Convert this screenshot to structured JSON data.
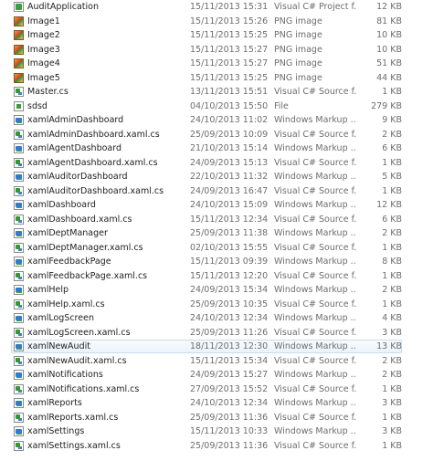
{
  "files": [
    {
      "name": "AuditApplication",
      "date": "15/11/2013 15:31",
      "type": "Visual C# Project f...",
      "size": "12 KB",
      "icon": "project-icon"
    },
    {
      "name": "Image1",
      "date": "15/11/2013 15:26",
      "type": "PNG image",
      "size": "81 KB",
      "icon": "png-icon"
    },
    {
      "name": "Image2",
      "date": "15/11/2013 15:25",
      "type": "PNG image",
      "size": "10 KB",
      "icon": "png-icon"
    },
    {
      "name": "Image3",
      "date": "15/11/2013 15:27",
      "type": "PNG image",
      "size": "10 KB",
      "icon": "png-icon"
    },
    {
      "name": "Image4",
      "date": "15/11/2013 15:27",
      "type": "PNG image",
      "size": "51 KB",
      "icon": "png-icon"
    },
    {
      "name": "Image5",
      "date": "15/11/2013 15:25",
      "type": "PNG image",
      "size": "44 KB",
      "icon": "png-icon"
    },
    {
      "name": "Master.cs",
      "date": "13/11/2013 15:51",
      "type": "Visual C# Source f...",
      "size": "1 KB",
      "icon": "cs-icon"
    },
    {
      "name": "sdsd",
      "date": "04/10/2013 15:50",
      "type": "File",
      "size": "279 KB",
      "icon": "file-icon"
    },
    {
      "name": "xamlAdminDashboard",
      "date": "24/10/2013 11:02",
      "type": "Windows Markup ...",
      "size": "9 KB",
      "icon": "xaml-icon"
    },
    {
      "name": "xamlAdminDashboard.xaml.cs",
      "date": "25/09/2013 10:09",
      "type": "Visual C# Source f...",
      "size": "2 KB",
      "icon": "cs-icon"
    },
    {
      "name": "xamlAgentDashboard",
      "date": "21/10/2013 15:14",
      "type": "Windows Markup ...",
      "size": "6 KB",
      "icon": "xaml-icon"
    },
    {
      "name": "xamlAgentDashboard.xaml.cs",
      "date": "24/09/2013 15:13",
      "type": "Visual C# Source f...",
      "size": "1 KB",
      "icon": "cs-icon"
    },
    {
      "name": "xamlAuditorDashboard",
      "date": "22/10/2013 11:32",
      "type": "Windows Markup ...",
      "size": "5 KB",
      "icon": "xaml-icon"
    },
    {
      "name": "xamlAuditorDashboard.xaml.cs",
      "date": "24/09/2013 16:47",
      "type": "Visual C# Source f...",
      "size": "1 KB",
      "icon": "cs-icon"
    },
    {
      "name": "xamlDashboard",
      "date": "24/10/2013 15:09",
      "type": "Windows Markup ...",
      "size": "12 KB",
      "icon": "xaml-icon"
    },
    {
      "name": "xamlDashboard.xaml.cs",
      "date": "15/11/2013 12:34",
      "type": "Visual C# Source f...",
      "size": "6 KB",
      "icon": "cs-icon"
    },
    {
      "name": "xamlDeptManager",
      "date": "25/09/2013 11:38",
      "type": "Windows Markup ...",
      "size": "2 KB",
      "icon": "xaml-icon"
    },
    {
      "name": "xamlDeptManager.xaml.cs",
      "date": "02/10/2013 15:55",
      "type": "Visual C# Source f...",
      "size": "1 KB",
      "icon": "cs-icon"
    },
    {
      "name": "xamlFeedbackPage",
      "date": "15/11/2013 09:39",
      "type": "Windows Markup ...",
      "size": "8 KB",
      "icon": "xaml-icon"
    },
    {
      "name": "xamlFeedbackPage.xaml.cs",
      "date": "15/11/2013 12:20",
      "type": "Visual C# Source f...",
      "size": "1 KB",
      "icon": "cs-icon"
    },
    {
      "name": "xamlHelp",
      "date": "24/09/2013 15:34",
      "type": "Windows Markup ...",
      "size": "2 KB",
      "icon": "xaml-icon"
    },
    {
      "name": "xamlHelp.xaml.cs",
      "date": "25/09/2013 10:35",
      "type": "Visual C# Source f...",
      "size": "1 KB",
      "icon": "cs-icon"
    },
    {
      "name": "xamlLogScreen",
      "date": "24/10/2013 12:34",
      "type": "Windows Markup ...",
      "size": "4 KB",
      "icon": "xaml-icon"
    },
    {
      "name": "xamlLogScreen.xaml.cs",
      "date": "25/09/2013 11:26",
      "type": "Visual C# Source f...",
      "size": "3 KB",
      "icon": "cs-icon"
    },
    {
      "name": "xamlNewAudit",
      "date": "18/11/2013 12:30",
      "type": "Windows Markup ...",
      "size": "13 KB",
      "icon": "xaml-icon",
      "selected": true
    },
    {
      "name": "xamlNewAudit.xaml.cs",
      "date": "15/11/2013 15:34",
      "type": "Visual C# Source f...",
      "size": "2 KB",
      "icon": "cs-icon"
    },
    {
      "name": "xamlNotifications",
      "date": "24/09/2013 15:27",
      "type": "Windows Markup ...",
      "size": "2 KB",
      "icon": "xaml-icon"
    },
    {
      "name": "xamlNotifications.xaml.cs",
      "date": "27/09/2013 15:52",
      "type": "Visual C# Source f...",
      "size": "1 KB",
      "icon": "cs-icon"
    },
    {
      "name": "xamlReports",
      "date": "24/10/2013 12:34",
      "type": "Windows Markup ...",
      "size": "3 KB",
      "icon": "xaml-icon"
    },
    {
      "name": "xamlReports.xaml.cs",
      "date": "25/09/2013 11:36",
      "type": "Visual C# Source f...",
      "size": "1 KB",
      "icon": "cs-icon"
    },
    {
      "name": "xamlSettings",
      "date": "15/11/2013 10:33",
      "type": "Windows Markup ...",
      "size": "3 KB",
      "icon": "xaml-icon"
    },
    {
      "name": "xamlSettings.xaml.cs",
      "date": "25/09/2013 11:36",
      "type": "Visual C# Source f...",
      "size": "1 KB",
      "icon": "cs-icon"
    }
  ]
}
